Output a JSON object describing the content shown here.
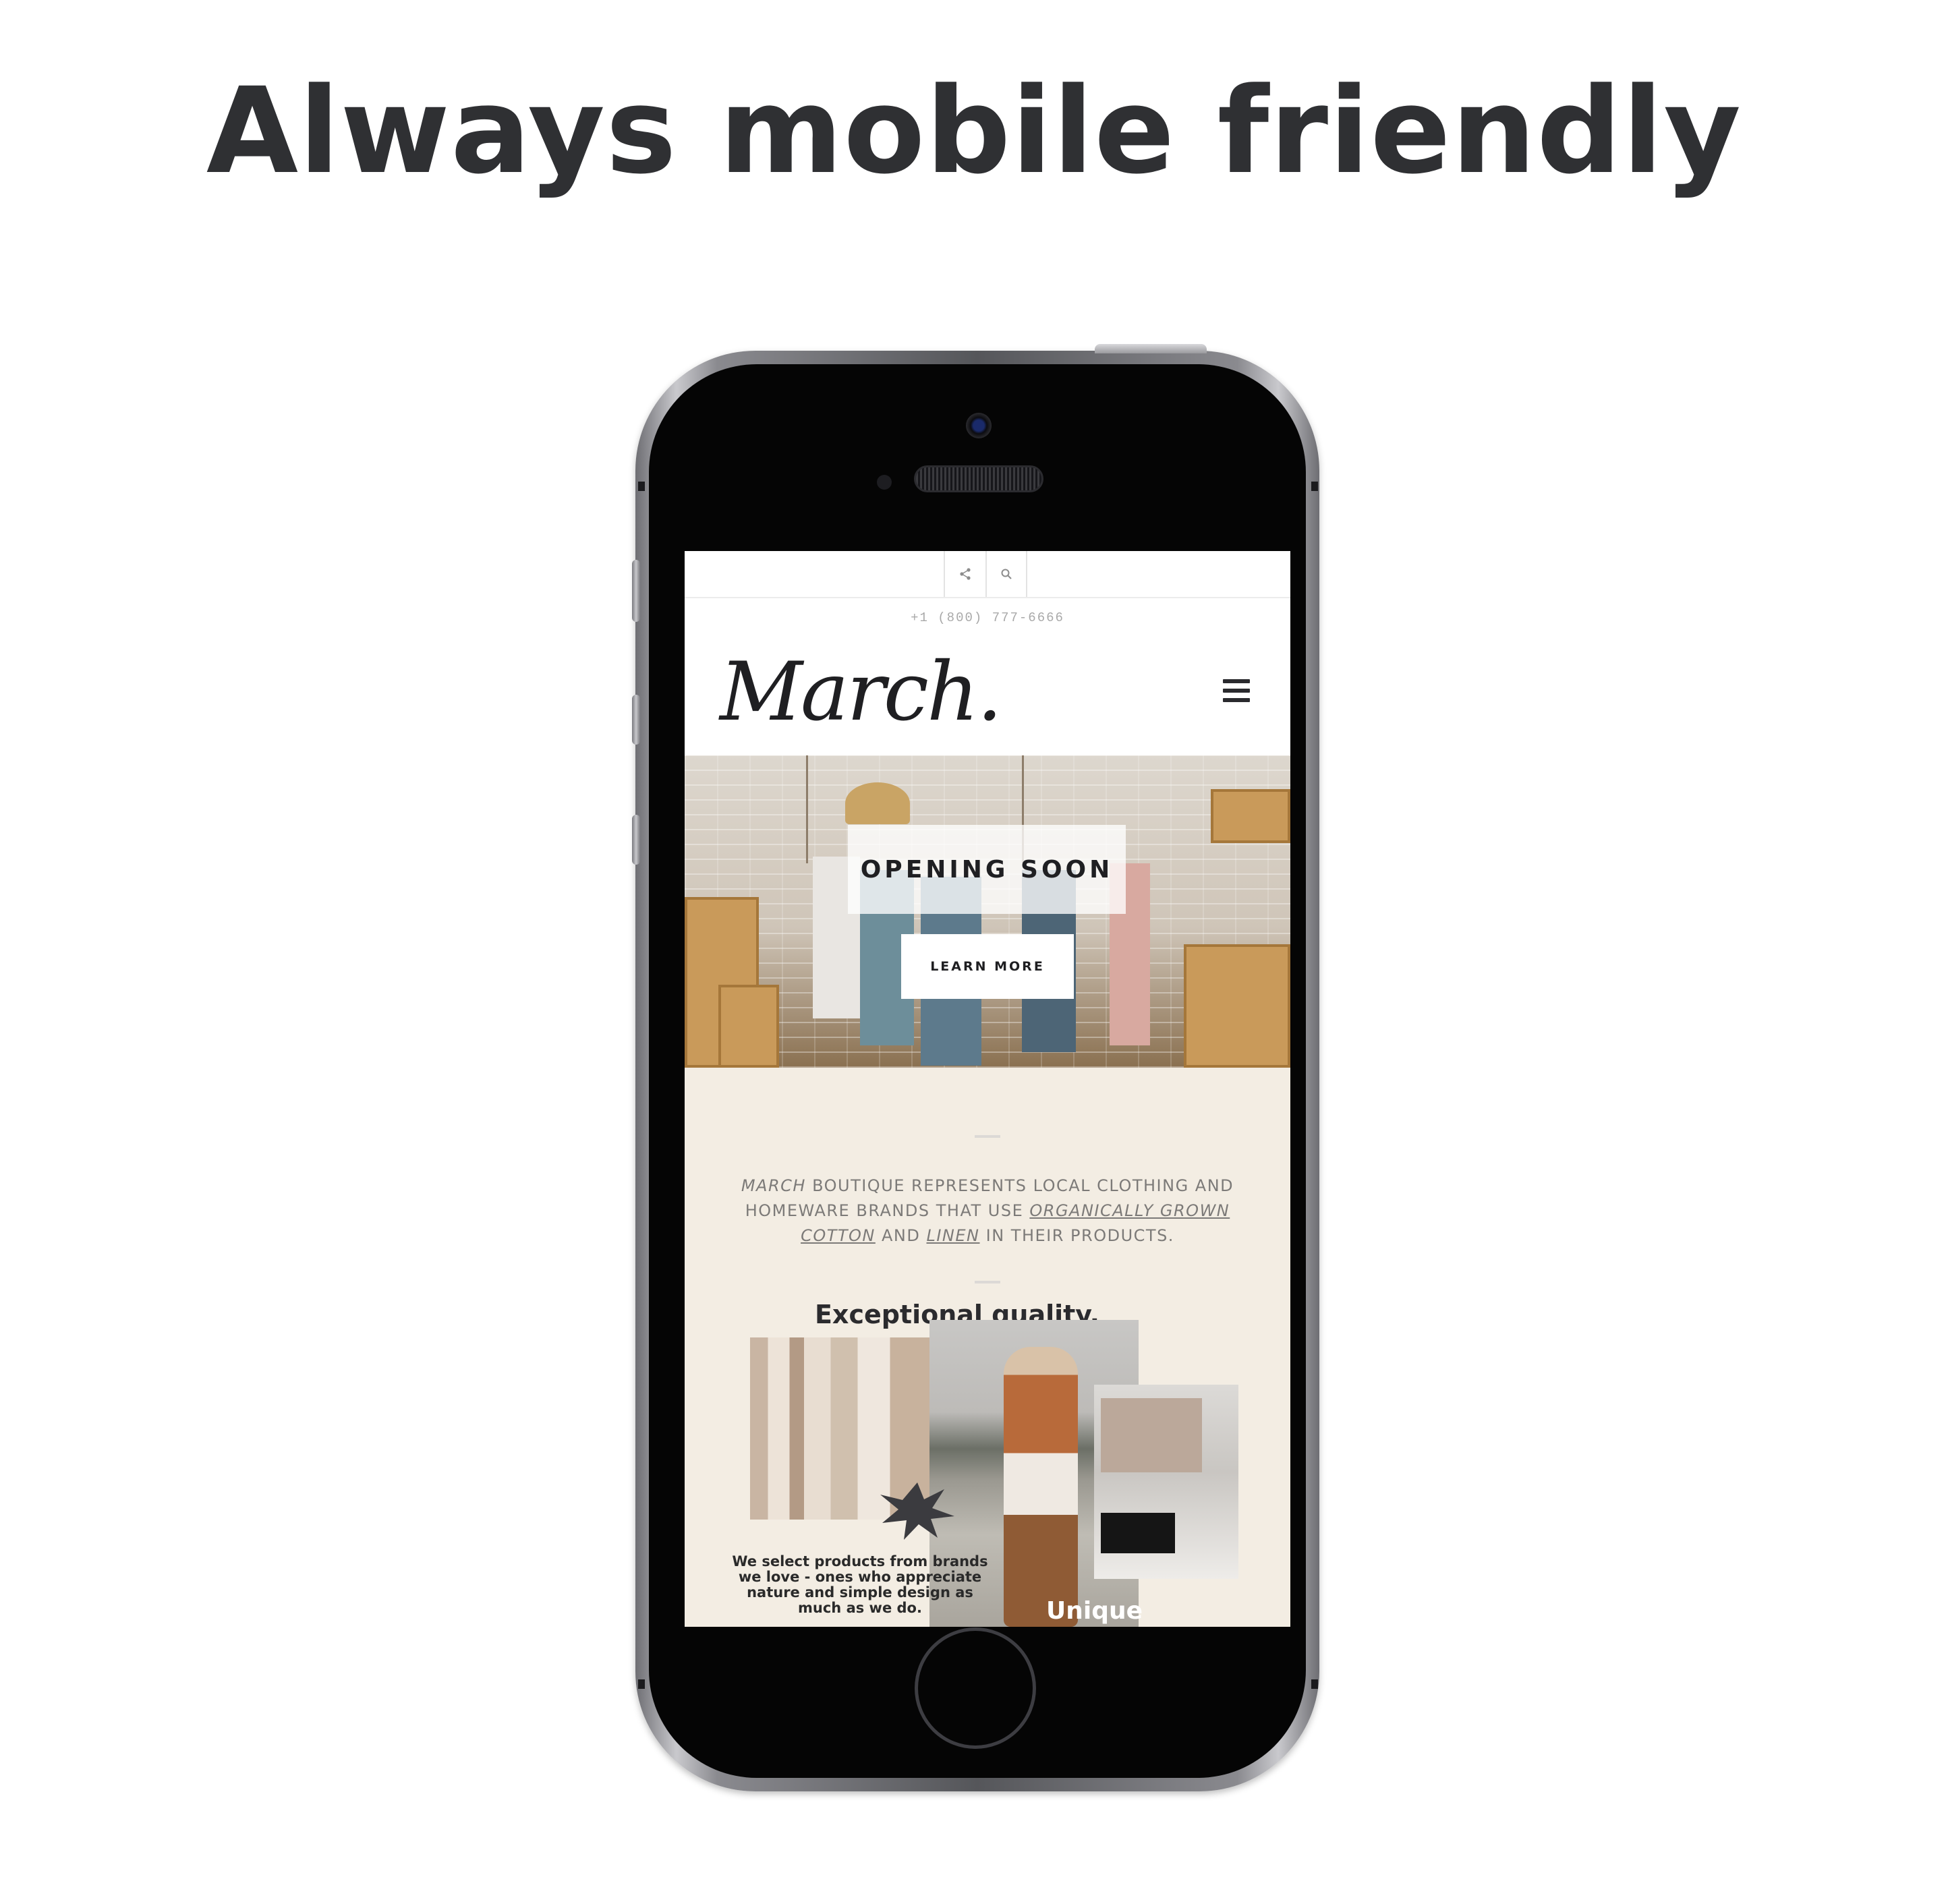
{
  "headline": "Always mobile friendly",
  "site": {
    "topbar": {
      "share_icon": "share-icon",
      "search_icon": "search-icon"
    },
    "phone_number": "+1 (800) 777-6666",
    "logo_text": "March.",
    "menu_icon": "hamburger-menu-icon",
    "hero": {
      "title": "OPENING SOON",
      "button_label": "LEARN MORE"
    },
    "about": {
      "brand": "MARCH",
      "text_1": " BOUTIQUE REPRESENTS LOCAL CLOTHING AND HOMEWARE BRANDS THAT USE ",
      "link_1": "ORGANICALLY GROWN COTTON",
      "text_2": " AND ",
      "link_2": "LINEN",
      "text_3": " IN THEIR PRODUCTS."
    },
    "quality_heading": "Exceptional quality.",
    "select_text": "We select products from brands we love - ones who appreciate nature and simple design as much as we do.",
    "unique_heading": "Unique design."
  },
  "colors": {
    "background": "#ffffff",
    "headline": "#2f3033",
    "about_bg": "#f3ede3",
    "text_muted": "#7c7a78"
  }
}
